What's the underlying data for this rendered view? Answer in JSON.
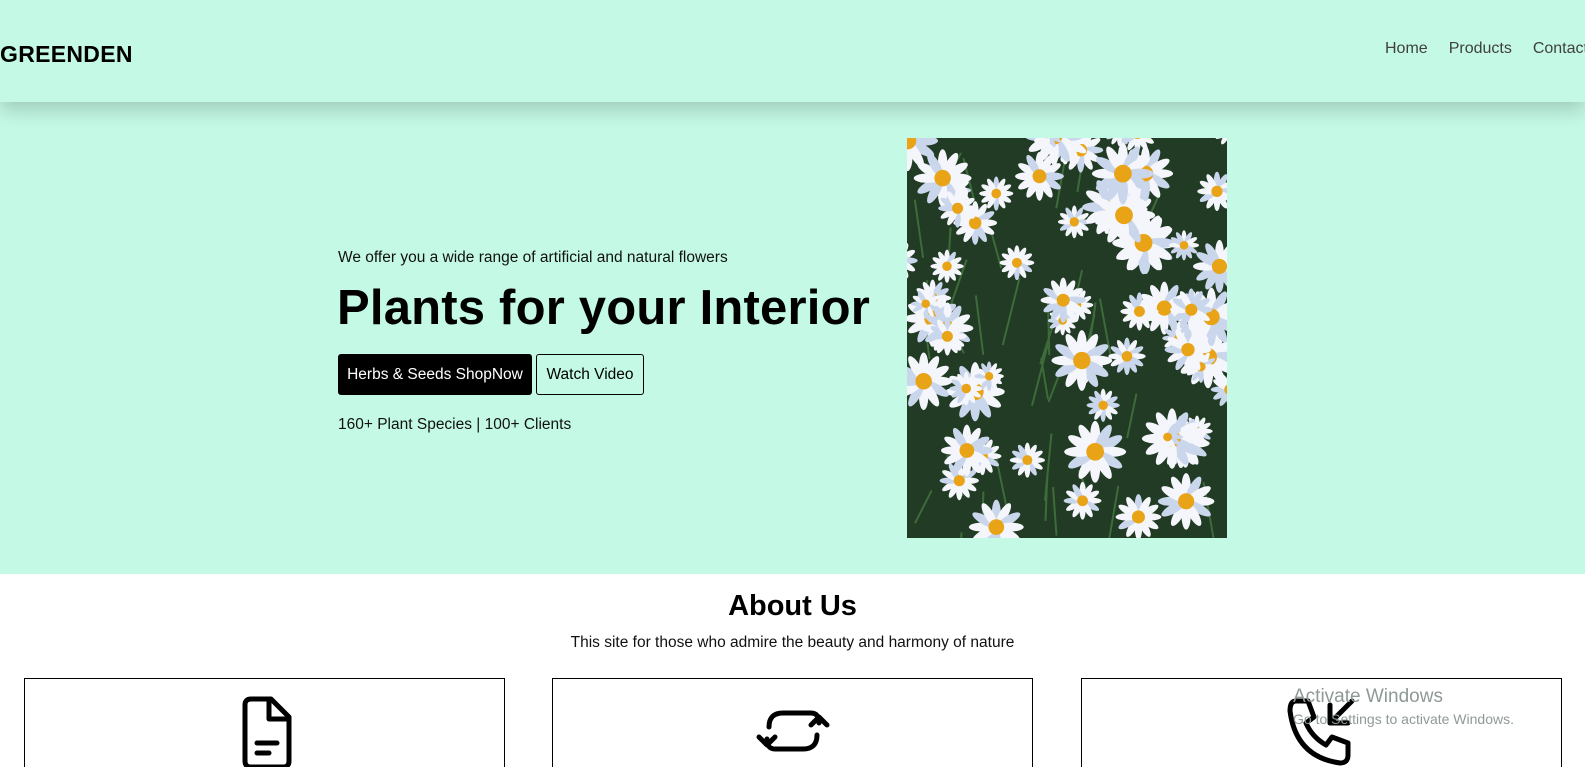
{
  "header": {
    "brand": "GREENDEN",
    "nav": [
      "Home",
      "Products",
      "Contact"
    ]
  },
  "hero": {
    "tagline": "We offer you a wide range of artificial and natural flowers",
    "title": "Plants for your Interior",
    "primary_button": "Herbs & Seeds ShopNow",
    "secondary_button": "Watch Video",
    "stats": "160+ Plant Species | 100+ Clients"
  },
  "about": {
    "title": "About Us",
    "subtitle": "This site for those who admire the beauty and harmony of nature",
    "cards": [
      {
        "icon": "document-icon"
      },
      {
        "icon": "refresh-icon"
      },
      {
        "icon": "phone-incoming-icon"
      }
    ]
  },
  "watermark": {
    "title": "Activate Windows",
    "subtitle": "Go to Settings to activate Windows."
  },
  "colors": {
    "mint_background": "#c3f9e5",
    "primary_button": "#000000"
  }
}
